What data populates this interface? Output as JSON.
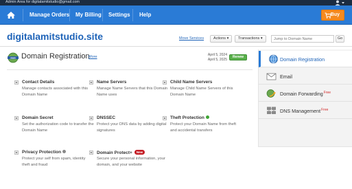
{
  "topbar": {
    "admin_text": "Admin Area for digitalamitstudio@gmail.com"
  },
  "nav": {
    "items": [
      "Manage Orders",
      "My Billing",
      "Settings",
      "Help"
    ],
    "buy_label": "Buy"
  },
  "domain": {
    "name": "digitalamitstudio.site",
    "move_services": "Move Services",
    "actions_label": "Actions",
    "transactions_label": "Transactions",
    "jump_placeholder": "Jump to Domain Name",
    "go_label": "Go"
  },
  "product": {
    "title": "Domain Registration",
    "more_label": "More",
    "date_1": "April 5, 2024",
    "date_2": "April 5, 2025",
    "renew_label": "Renew"
  },
  "features": [
    {
      "title": "Contact Details",
      "desc": "Manage contacts associated with this Domain Name"
    },
    {
      "title": "Name Servers",
      "desc": "Manage Name Servers that this Domain Name uses"
    },
    {
      "title": "Child Name Servers",
      "desc": "Manage Child Name Servers of this Domain Name"
    },
    {
      "title": "Domain Secret",
      "desc": "Set the authorization code to transfer the Domain Name"
    },
    {
      "title": "DNSSEC",
      "desc": "Protect your DNS data by adding digital signatures"
    },
    {
      "title": "Theft Protection",
      "desc": "Protect your Domain Name from theft and accidental transfers"
    },
    {
      "title": "Privacy Protection",
      "desc": "Protect your self from spam, identity theft and fraud"
    },
    {
      "title": "Domain Protect+",
      "desc": "Secure your personal information, your domain, and your website",
      "badge": "New"
    }
  ],
  "sidebar": {
    "items": [
      {
        "label": "Domain Registration",
        "icon": "domain-globe-icon",
        "active": true
      },
      {
        "label": "Email",
        "icon": "envelope-icon"
      },
      {
        "label": "Domain Forwarding",
        "icon": "forwarding-icon",
        "tag": "Free"
      },
      {
        "label": "DNS Management",
        "icon": "dns-server-icon",
        "tag": "Free"
      }
    ]
  },
  "colors": {
    "nav_bg": "#2a7bd6",
    "link": "#1e63b8",
    "buy": "#f58a1f",
    "renew": "#5ab04c",
    "new_badge": "#c41c24",
    "free_tag": "#d32a2a"
  }
}
